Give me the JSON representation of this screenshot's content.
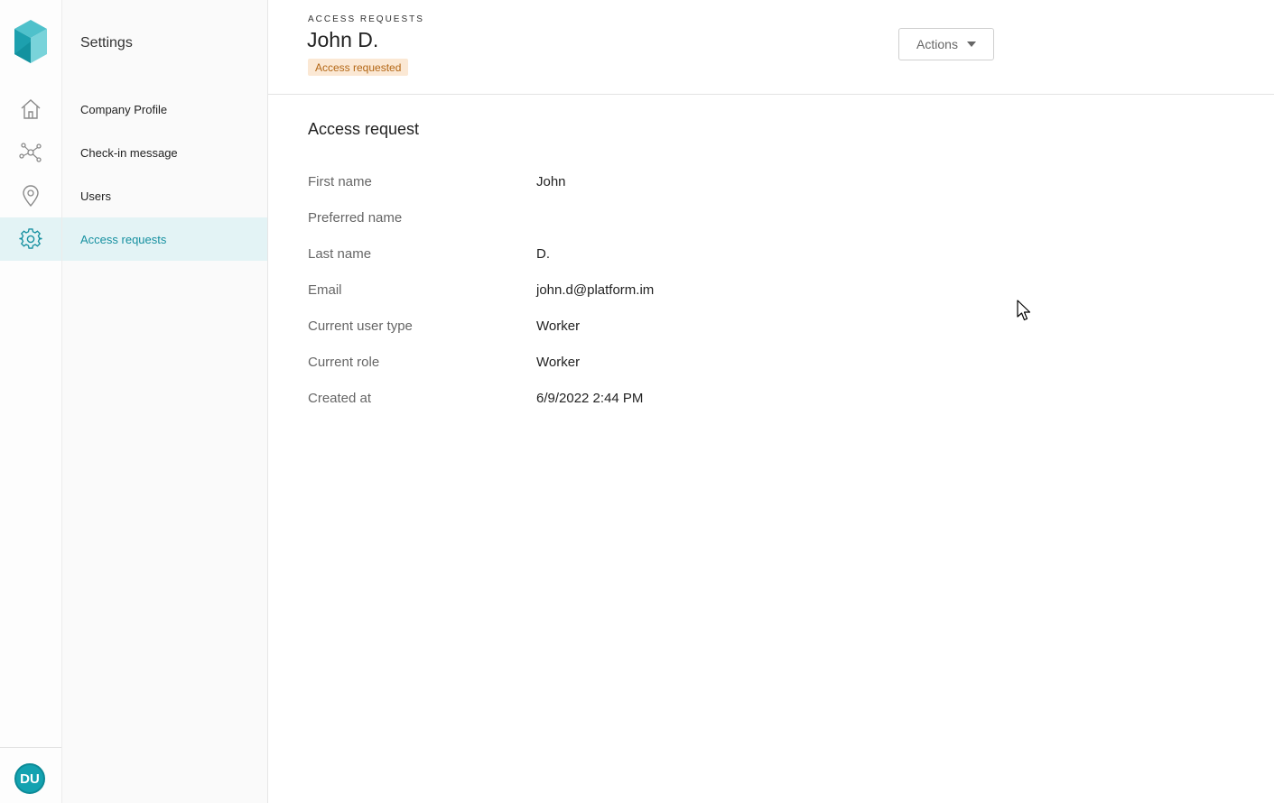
{
  "app": {
    "avatar_initials": "DU",
    "accent_color": "#13a2b0",
    "active_bg": "#e3f3f5"
  },
  "rail": {
    "items": [
      {
        "icon": "home-icon"
      },
      {
        "icon": "network-icon"
      },
      {
        "icon": "location-pin-icon"
      },
      {
        "icon": "gear-icon",
        "active": true
      }
    ]
  },
  "subnav": {
    "title": "Settings",
    "items": [
      {
        "label": "Company Profile"
      },
      {
        "label": "Check-in message"
      },
      {
        "label": "Users"
      },
      {
        "label": "Access requests",
        "active": true
      }
    ]
  },
  "header": {
    "eyebrow": "ACCESS REQUESTS",
    "title": "John D.",
    "status_badge": "Access requested",
    "actions_label": "Actions"
  },
  "detail": {
    "section_title": "Access request",
    "fields": [
      {
        "label": "First name",
        "value": "John"
      },
      {
        "label": "Preferred name",
        "value": ""
      },
      {
        "label": "Last name",
        "value": "D."
      },
      {
        "label": "Email",
        "value": "john.d@platform.im"
      },
      {
        "label": "Current user type",
        "value": "Worker"
      },
      {
        "label": "Current role",
        "value": "Worker"
      },
      {
        "label": "Created at",
        "value": "6/9/2022 2:44 PM"
      }
    ]
  }
}
